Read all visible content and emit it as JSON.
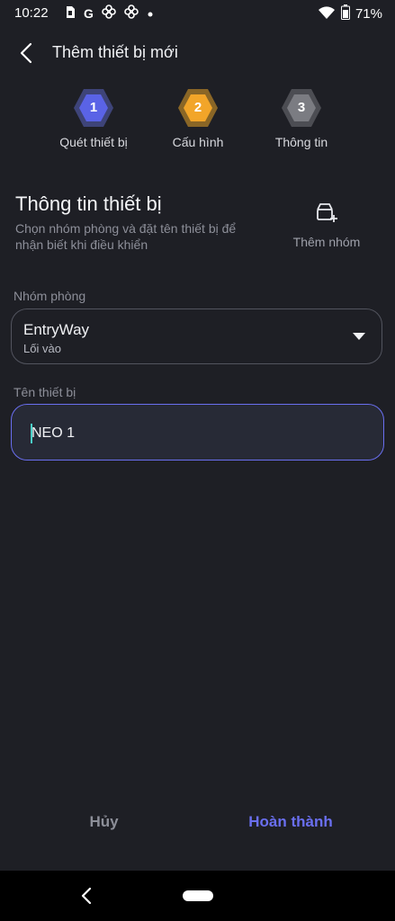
{
  "status_bar": {
    "time": "10:22",
    "left_icons": [
      "sim-icon",
      "google-g-icon",
      "pinwheel-icon",
      "pinwheel-icon",
      "dot-icon"
    ],
    "google_letter": "G",
    "battery_percent": "71%"
  },
  "app_bar": {
    "title": "Thêm thiết bị mới"
  },
  "stepper": {
    "steps": [
      {
        "number": "1",
        "label": "Quét thiết bị",
        "color": "#5a63e6",
        "ring": "#3e4479"
      },
      {
        "number": "2",
        "label": "Cấu hình",
        "color": "#f2a529",
        "ring": "#8a6626"
      },
      {
        "number": "3",
        "label": "Thông tin",
        "color": "#7b7c82",
        "ring": "#4c4d53"
      }
    ]
  },
  "section": {
    "title": "Thông tin thiết bị",
    "description": "Chọn nhóm phòng và đặt tên thiết bị để nhận biết khi điều khiển",
    "add_group_label": "Thêm nhóm"
  },
  "room_group": {
    "label": "Nhóm phòng",
    "value": "EntryWay",
    "sub_value": "Lối vào"
  },
  "device_name": {
    "label": "Tên thiết bị",
    "value": "NEO 1"
  },
  "actions": {
    "cancel": "Hủy",
    "done": "Hoàn thành"
  },
  "colors": {
    "accent": "#6a6ff0",
    "background": "#1e1f25"
  }
}
